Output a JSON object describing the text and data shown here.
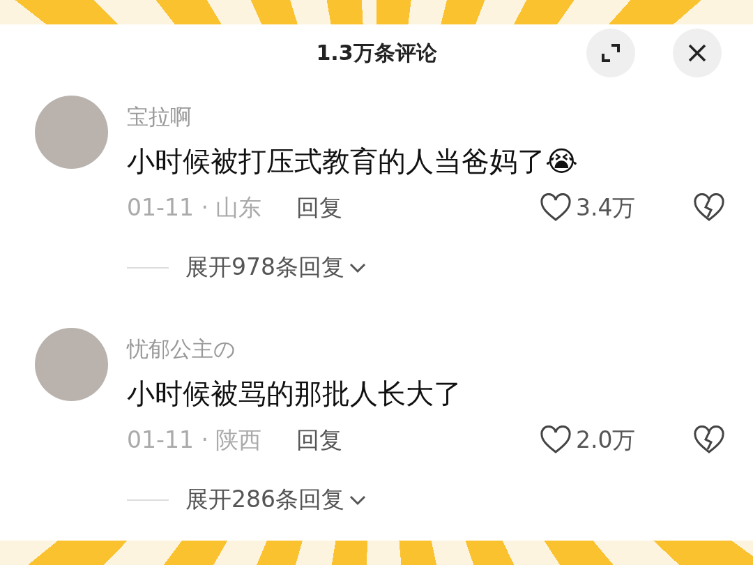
{
  "header": {
    "title": "1.3万条评论"
  },
  "comments": [
    {
      "user": "宝拉啊",
      "text": "小时候被打压式教育的人当爸妈了😭",
      "date": "01-11 · 山东",
      "reply": "回复",
      "likes": "3.4万",
      "expand": "展开978条回复"
    },
    {
      "user": "忧郁公主の",
      "text": "小时候被骂的那批人长大了",
      "date": "01-11 · 陕西",
      "reply": "回复",
      "likes": "2.0万",
      "expand": "展开286条回复"
    }
  ]
}
